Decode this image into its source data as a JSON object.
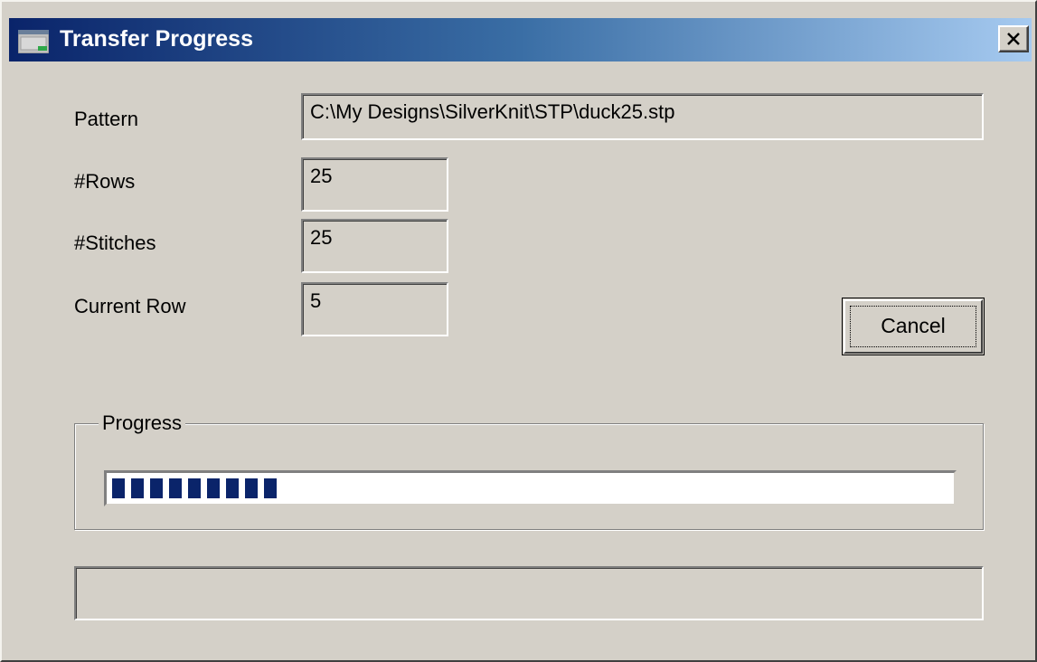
{
  "window": {
    "title": "Transfer Progress",
    "close_label": "X"
  },
  "form": {
    "pattern_label": "Pattern",
    "pattern_value": "C:\\My Designs\\SilverKnit\\STP\\duck25.stp",
    "rows_label": "#Rows",
    "rows_value": "25",
    "stitches_label": "#Stitches",
    "stitches_value": "25",
    "current_row_label": "Current Row",
    "current_row_value": "5"
  },
  "buttons": {
    "cancel_label": "Cancel"
  },
  "progress": {
    "group_label": "Progress",
    "fraction": 0.2
  },
  "status": {
    "text": ""
  },
  "colors": {
    "title_gradient_start": "#0a246a",
    "progress_fill": "#0a246a",
    "dialog_face": "#d4d0c8"
  },
  "icons": {
    "app": "window-app-icon",
    "close": "close-icon"
  }
}
